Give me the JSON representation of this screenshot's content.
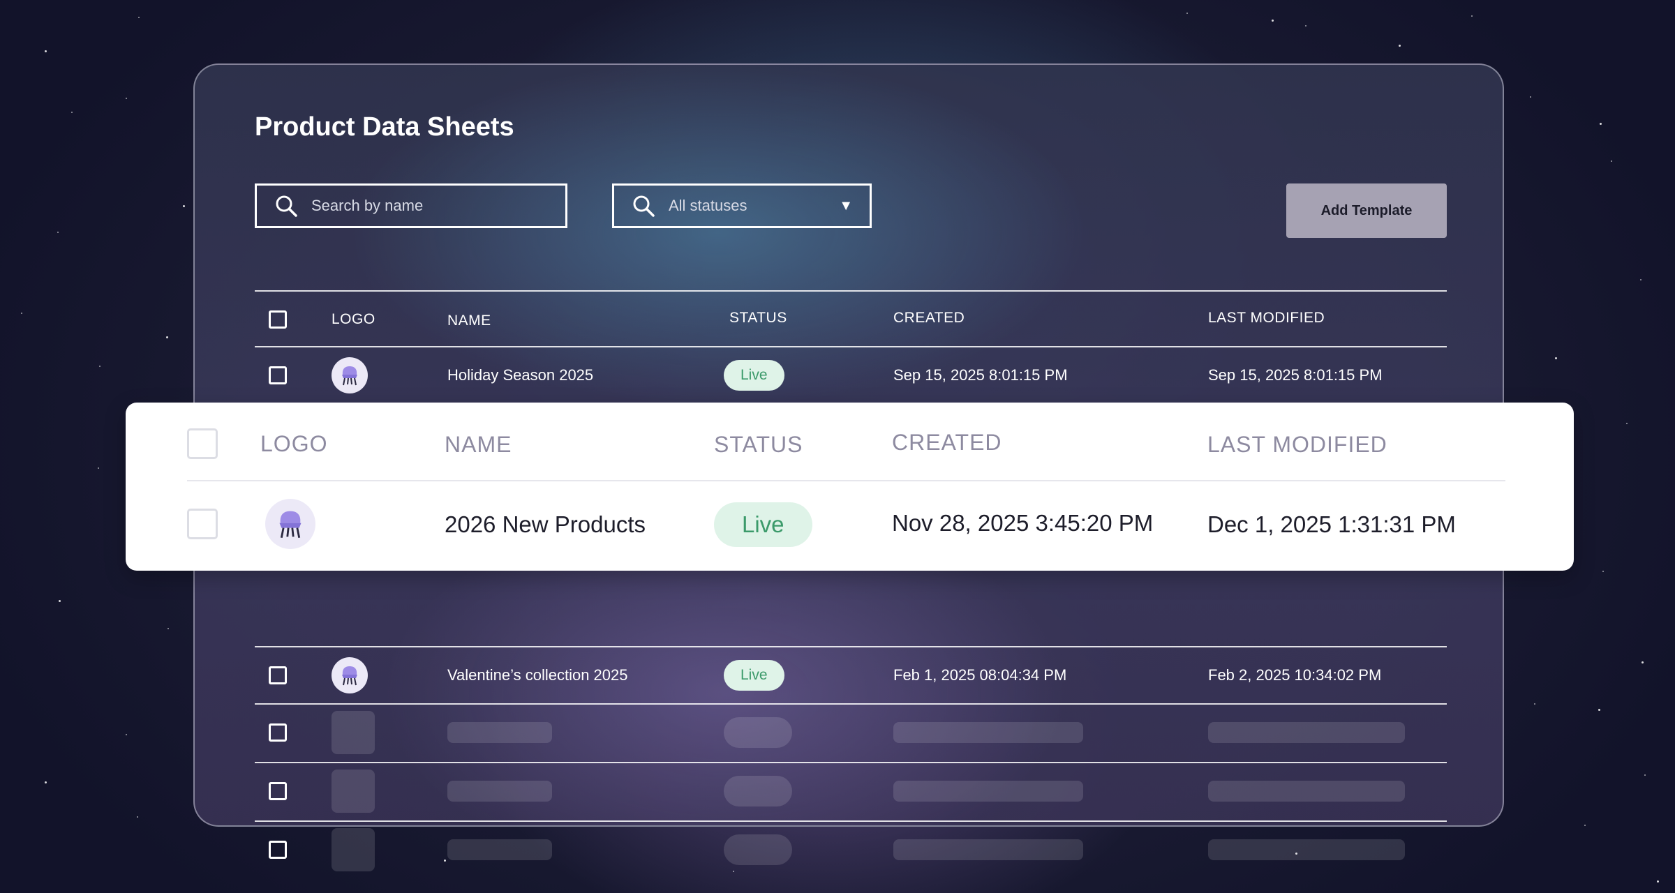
{
  "page_title": "Product Data Sheets",
  "search": {
    "placeholder": "Search by name",
    "icon": "search-icon"
  },
  "status_filter": {
    "selected": "All statuses",
    "icon": "search-icon",
    "caret": "▼"
  },
  "add_button": "Add Template",
  "columns": {
    "logo": "LOGO",
    "name": "NAME",
    "status": "STATUS",
    "created": "CREATED",
    "last_modified": "LAST MODIFIED"
  },
  "rows": [
    {
      "name": "Holiday Season 2025",
      "status": "Live",
      "created": "Sep 15, 2025 8:01:15 PM",
      "last_modified": "Sep 15, 2025 8:01:15 PM"
    },
    {
      "name": "Valentine’s collection 2025",
      "status": "Live",
      "created": "Feb 1, 2025 08:04:34 PM",
      "last_modified": "Feb 2, 2025 10:34:02 PM"
    }
  ],
  "highlighted_row": {
    "columns": {
      "logo": "LOGO",
      "name": "NAME",
      "status": "STATUS",
      "created": "CREATED",
      "last_modified": "LAST MODIFIED"
    },
    "name": "2026 New Products",
    "status": "Live",
    "created": "Nov 28, 2025 3:45:20 PM",
    "last_modified": "Dec 1, 2025 1:31:31 PM"
  },
  "colors": {
    "status_live_bg": "#dff3e8",
    "status_live_text": "#3b9a6a",
    "chair_icon": "#8f7de0",
    "add_button_bg": "#a6a2b3"
  },
  "icons": {
    "logo": "chair-icon",
    "dropdown": "caret-down-icon"
  }
}
